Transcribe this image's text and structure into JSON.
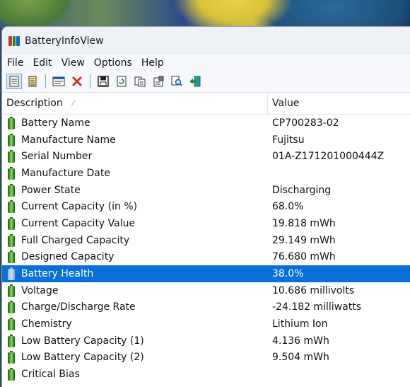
{
  "window": {
    "title": "BatteryInfoView"
  },
  "menu": [
    "File",
    "Edit",
    "View",
    "Options",
    "Help"
  ],
  "toolbar": [
    {
      "icon": "list-view-icon"
    },
    {
      "icon": "html-report-icon"
    },
    {
      "icon": "properties-icon"
    },
    {
      "icon": "delete-icon"
    },
    {
      "icon": "save-icon"
    },
    {
      "icon": "refresh-icon"
    },
    {
      "icon": "copy-icon"
    },
    {
      "icon": "options-icon"
    },
    {
      "icon": "find-icon"
    },
    {
      "icon": "exit-icon"
    }
  ],
  "columns": {
    "description": "Description",
    "value": "Value"
  },
  "rows": [
    {
      "description": "Battery Name",
      "value": "CP700283-02"
    },
    {
      "description": "Manufacture Name",
      "value": "Fujitsu"
    },
    {
      "description": "Serial Number",
      "value": "01A-Z171201000444Z"
    },
    {
      "description": "Manufacture Date",
      "value": ""
    },
    {
      "description": "Power State",
      "value": "Discharging"
    },
    {
      "description": "Current Capacity (in %)",
      "value": "68.0%"
    },
    {
      "description": "Current Capacity Value",
      "value": "19.818 mWh"
    },
    {
      "description": "Full Charged Capacity",
      "value": "29.149 mWh"
    },
    {
      "description": "Designed Capacity",
      "value": "76.680 mWh"
    },
    {
      "description": "Battery Health",
      "value": "38.0%",
      "selected": true
    },
    {
      "description": "Voltage",
      "value": "10.686 millivolts"
    },
    {
      "description": "Charge/Discharge Rate",
      "value": "-24.182 milliwatts"
    },
    {
      "description": "Chemistry",
      "value": "Lithium Ion"
    },
    {
      "description": "Low Battery Capacity (1)",
      "value": "4.136 mWh"
    },
    {
      "description": "Low Battery Capacity (2)",
      "value": "9.504 mWh"
    },
    {
      "description": "Critical Bias",
      "value": ""
    }
  ],
  "colors": {
    "selection": "#0a6fd6",
    "battery_green": "#4ea53a"
  }
}
